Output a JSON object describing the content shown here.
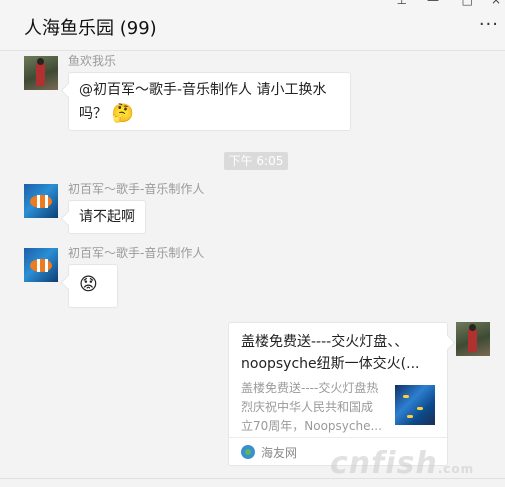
{
  "header": {
    "title": "人海鱼乐园 (99)",
    "more_label": "···",
    "window_controls": [
      "⊥",
      "—",
      "□",
      "×"
    ]
  },
  "messages": [
    {
      "sender": "鱼欢我乐",
      "text": "@初百军～歌手-音乐制作人 请小工换水吗？",
      "emoji": "🤔"
    },
    {
      "sender": "初百军～歌手-音乐制作人",
      "text": "请不起啊"
    },
    {
      "sender": "初百军～歌手-音乐制作人",
      "emoji": "😟"
    }
  ],
  "time_divider": "下午 6:05",
  "link_card": {
    "title": "盖楼免费送----交火灯盘、、noopsyche纽斯一体交火(...",
    "description": "盖楼免费送----交火灯盘热烈庆祝中华人民共和国成立70周年，Noopsyche...",
    "source": "海友网"
  },
  "watermark": {
    "main": "cnfish",
    "sub": ".com"
  }
}
